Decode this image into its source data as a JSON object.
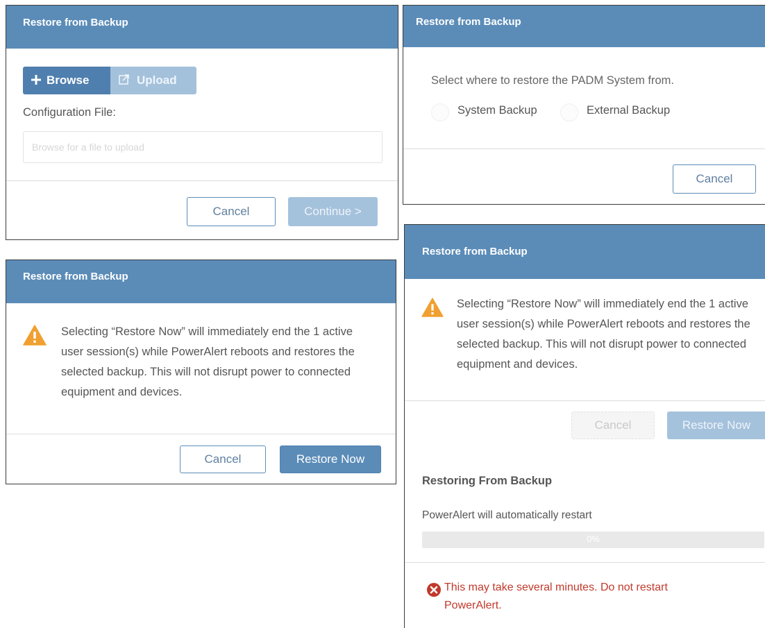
{
  "dialog1": {
    "title": "Restore from Backup",
    "browse_label": "Browse",
    "upload_label": "Upload",
    "config_label": "Configuration File:",
    "config_placeholder": "Browse for a file to upload",
    "cancel_label": "Cancel",
    "continue_label": "Continue >"
  },
  "dialog2": {
    "title": "Restore from Backup",
    "prompt": "Select where to restore the PADM System from.",
    "options": [
      {
        "label": "System Backup",
        "selected": false
      },
      {
        "label": "External Backup",
        "selected": false
      }
    ],
    "cancel_label": "Cancel"
  },
  "dialog3": {
    "title": "Restore from Backup",
    "warning_text": "Selecting “Restore Now” will immediately end the 1 active user session(s) while PowerAlert reboots and restores the selected backup. This will not disrupt power to connected equipment and devices.",
    "cancel_label": "Cancel",
    "restore_label": "Restore Now"
  },
  "dialog4": {
    "title": "Restore from Backup",
    "warning_text": "Selecting “Restore Now” will immediately end the 1 active user session(s) while PowerAlert reboots and restores the selected backup. This will not disrupt power to connected equipment and devices.",
    "cancel_label": "Cancel",
    "restore_label": "Restore Now",
    "restoring_title": "Restoring From Backup",
    "restart_note": "PowerAlert will automatically restart",
    "progress_value": 0,
    "progress_text": "0%",
    "error_text": "This may take several minutes. Do not restart PowerAlert."
  },
  "colors": {
    "header": "#5b8cb8",
    "primary": "#5b8cb8",
    "warning": "#f0a030",
    "error": "#c0392b"
  },
  "icons": {
    "plus": "plus-icon",
    "upload": "upload-icon",
    "warning": "warning-icon",
    "error": "error-icon"
  }
}
